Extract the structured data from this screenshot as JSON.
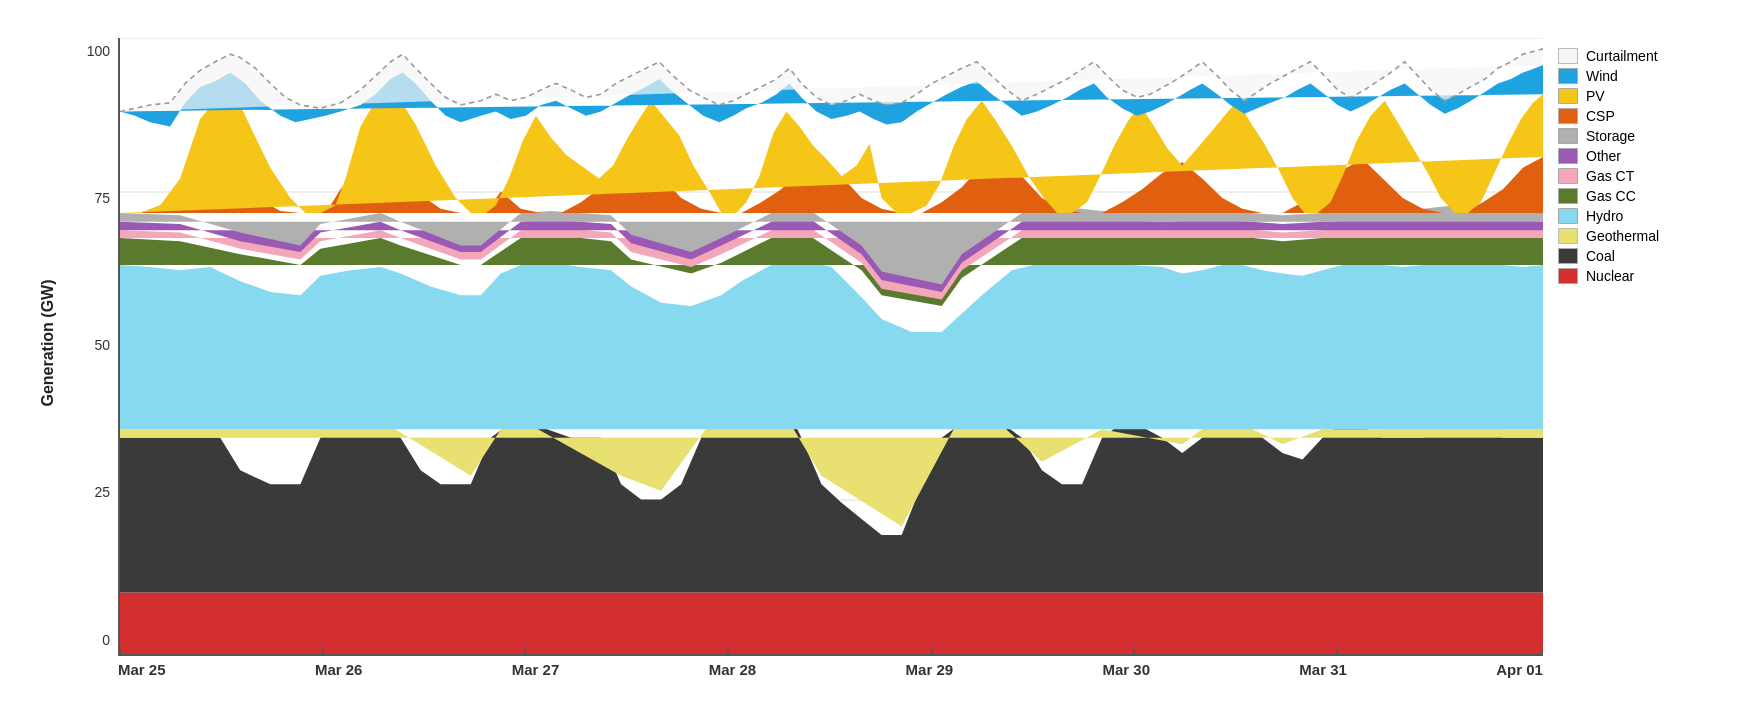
{
  "chart": {
    "title": "Generation (GW)",
    "y_axis": {
      "ticks": [
        "0",
        "25",
        "50",
        "75",
        "100"
      ]
    },
    "x_axis": {
      "ticks": [
        "Mar 25",
        "Mar 26",
        "Mar 27",
        "Mar 28",
        "Mar 29",
        "Mar 30",
        "Mar 31",
        "Apr 01"
      ]
    }
  },
  "legend": {
    "items": [
      {
        "label": "Curtailment",
        "color": "#f5f5f5",
        "border": "#bbb"
      },
      {
        "label": "Wind",
        "color": "#1fa2e0"
      },
      {
        "label": "PV",
        "color": "#f5c518"
      },
      {
        "label": "CSP",
        "color": "#e06010"
      },
      {
        "label": "Storage",
        "color": "#b0b0b0"
      },
      {
        "label": "Other",
        "color": "#9b59b6"
      },
      {
        "label": "Gas CT",
        "color": "#f4a7b9"
      },
      {
        "label": "Gas CC",
        "color": "#5a7a2e"
      },
      {
        "label": "Hydro",
        "color": "#87d9f0"
      },
      {
        "label": "Geothermal",
        "color": "#e8e8a0"
      },
      {
        "label": "Coal",
        "color": "#404040"
      },
      {
        "label": "Nuclear",
        "color": "#d32f2f"
      }
    ]
  }
}
